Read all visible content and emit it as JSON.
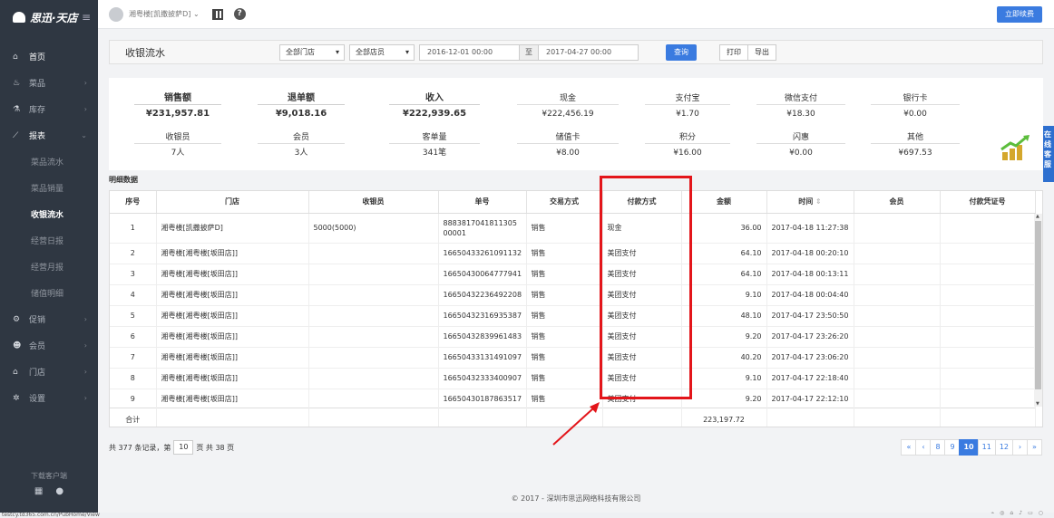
{
  "app": {
    "brand": "思迅·天店",
    "user": "湘粤楼[凯撒披萨D]",
    "renew_button": "立即续费",
    "status_url": "testcy.td365.com.cn/PubHome/View"
  },
  "sidebar": {
    "items": [
      {
        "label": "首页",
        "icon": "home-icon"
      },
      {
        "label": "菜品",
        "icon": "dish-icon"
      },
      {
        "label": "库存",
        "icon": "stock-icon"
      },
      {
        "label": "报表",
        "icon": "chart-icon"
      },
      {
        "label": "菜品流水"
      },
      {
        "label": "菜品销量"
      },
      {
        "label": "收银流水"
      },
      {
        "label": "经营日报"
      },
      {
        "label": "经营月报"
      },
      {
        "label": "储值明细"
      },
      {
        "label": "促销",
        "icon": "promo-icon"
      },
      {
        "label": "会员",
        "icon": "member-icon"
      },
      {
        "label": "门店",
        "icon": "store-icon"
      },
      {
        "label": "设置",
        "icon": "settings-icon"
      }
    ],
    "download_label": "下载客户端"
  },
  "toolbar": {
    "title": "收银流水",
    "store_select": "全部门店",
    "cashier_select": "全部店员",
    "date_from": "2016-12-01 00:00",
    "to_label": "至",
    "date_to": "2017-04-27 00:00",
    "query_button": "查询",
    "print_button": "打印",
    "export_button": "导出"
  },
  "summary": {
    "sales_label": "销售额",
    "sales_value": "¥231,957.81",
    "refund_label": "退单额",
    "refund_value": "¥9,018.16",
    "income_label": "收入",
    "income_value": "¥222,939.65",
    "cashier_label": "收银员",
    "cashier_value": "7人",
    "member_label": "会员",
    "member_value": "3人",
    "orders_label": "客单量",
    "orders_value": "341笔",
    "cash_label": "现金",
    "cash_value": "¥222,456.19",
    "alipay_label": "支付宝",
    "alipay_value": "¥1.70",
    "wechat_label": "微信支付",
    "wechat_value": "¥18.30",
    "bank_label": "银行卡",
    "bank_value": "¥0.00",
    "stored_label": "储值卡",
    "stored_value": "¥8.00",
    "points_label": "积分",
    "points_value": "¥16.00",
    "flash_label": "闪惠",
    "flash_value": "¥0.00",
    "other_label": "其他",
    "other_value": "¥697.53",
    "side_tab": "在线客服"
  },
  "detail": {
    "title": "明细数据",
    "columns": [
      "序号",
      "门店",
      "收银员",
      "单号",
      "交易方式",
      "付款方式",
      "金额",
      "时间",
      "会员",
      "付款凭证号"
    ],
    "rows": [
      [
        "1",
        "湘粤楼[凯撒披萨D]",
        "5000(5000)",
        "888381704181130500001",
        "销售",
        "现金",
        "36.00",
        "2017-04-18 11:27:38",
        "",
        ""
      ],
      [
        "2",
        "湘粤楼[湘粤楼[坂田店]]",
        "",
        "16650433261091132",
        "销售",
        "美团支付",
        "64.10",
        "2017-04-18 00:20:10",
        "",
        ""
      ],
      [
        "3",
        "湘粤楼[湘粤楼[坂田店]]",
        "",
        "16650430064777941",
        "销售",
        "美团支付",
        "64.10",
        "2017-04-18 00:13:11",
        "",
        ""
      ],
      [
        "4",
        "湘粤楼[湘粤楼[坂田店]]",
        "",
        "16650432236492208",
        "销售",
        "美团支付",
        "9.10",
        "2017-04-18 00:04:40",
        "",
        ""
      ],
      [
        "5",
        "湘粤楼[湘粤楼[坂田店]]",
        "",
        "16650432316935387",
        "销售",
        "美团支付",
        "48.10",
        "2017-04-17 23:50:50",
        "",
        ""
      ],
      [
        "6",
        "湘粤楼[湘粤楼[坂田店]]",
        "",
        "16650432839961483",
        "销售",
        "美团支付",
        "9.20",
        "2017-04-17 23:26:20",
        "",
        ""
      ],
      [
        "7",
        "湘粤楼[湘粤楼[坂田店]]",
        "",
        "16650433131491097",
        "销售",
        "美团支付",
        "40.20",
        "2017-04-17 23:06:20",
        "",
        ""
      ],
      [
        "8",
        "湘粤楼[湘粤楼[坂田店]]",
        "",
        "16650432333400907",
        "销售",
        "美团支付",
        "9.10",
        "2017-04-17 22:18:40",
        "",
        ""
      ],
      [
        "9",
        "湘粤楼[湘粤楼[坂田店]]",
        "",
        "16650430187863517",
        "销售",
        "美团支付",
        "9.20",
        "2017-04-17 22:12:10",
        "",
        ""
      ]
    ],
    "total_label": "合计",
    "total_amount": "223,197.72"
  },
  "pager": {
    "info_prefix": "共 377 条记录，第",
    "current": "10",
    "info_suffix": "页 共 38 页",
    "buttons": [
      "«",
      "‹",
      "8",
      "9",
      "10",
      "11",
      "12",
      "›",
      "»"
    ]
  },
  "footer": "© 2017 - 深圳市思迅网络科技有限公司",
  "colors": {
    "accent": "#3a7be0",
    "sidebar": "#2f3742",
    "highlight": "#e3151a"
  }
}
